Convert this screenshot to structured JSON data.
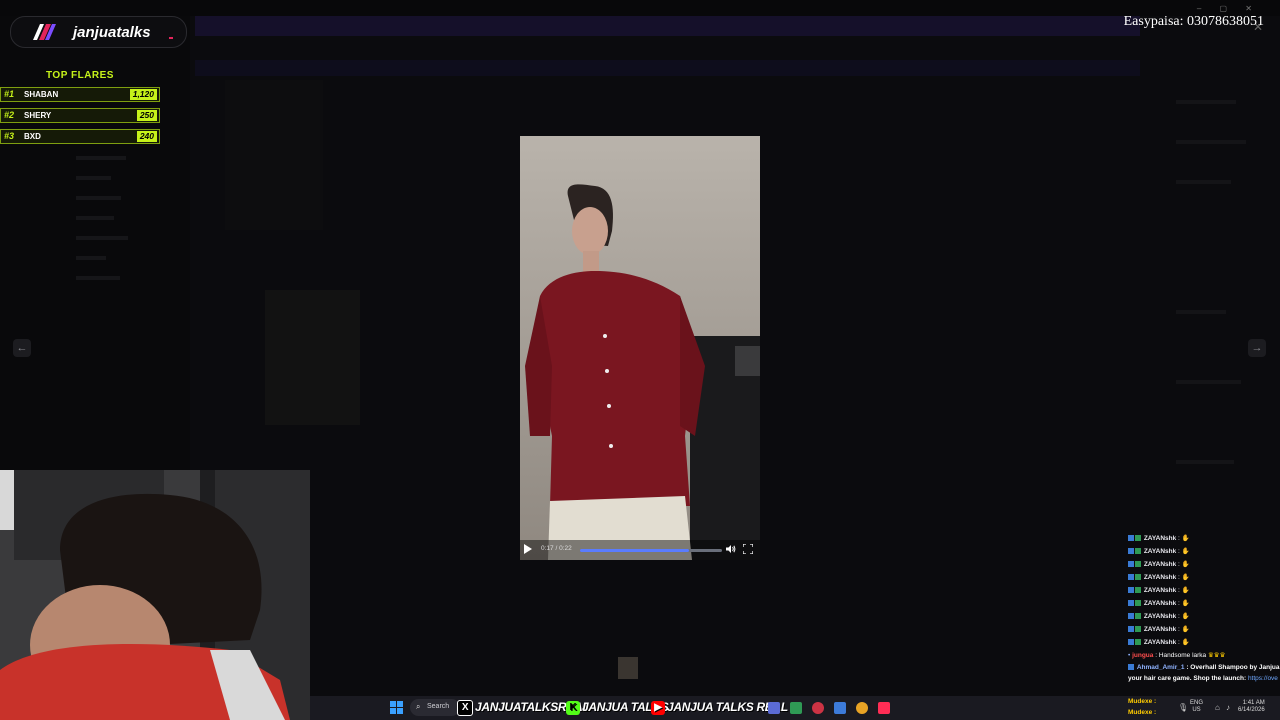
{
  "stream": {
    "logo_text": "janjuatalks",
    "easypaisa": "Easypaisa: 03078638051"
  },
  "top_flares": {
    "title": "TOP FLARES",
    "entries": [
      {
        "rank": "#1",
        "name": "SHABAN",
        "value": "1,120"
      },
      {
        "rank": "#2",
        "name": "SHERY",
        "value": "250"
      },
      {
        "rank": "#3",
        "name": "BXD",
        "value": "240"
      }
    ]
  },
  "video_player": {
    "time": "0:17 / 0:22",
    "progress": 0.77
  },
  "chat": {
    "messages": [
      {
        "user": "ZAYANshk",
        "text": ":"
      },
      {
        "user": "ZAYANshk",
        "text": ":"
      },
      {
        "user": "ZAYANshk",
        "text": ":"
      },
      {
        "user": "ZAYANshk",
        "text": ":"
      },
      {
        "user": "ZAYANshk",
        "text": ":"
      },
      {
        "user": "ZAYANshk",
        "text": ":"
      },
      {
        "user": "ZAYANshk",
        "text": ":"
      },
      {
        "user": "ZAYANshk",
        "text": ":"
      },
      {
        "user": "ZAYANshk",
        "text": ":"
      }
    ],
    "jungua": {
      "user": "jungua",
      "text": ": Handsome larka"
    },
    "sponsor": {
      "user": "Ahmad_Amir_1",
      "text": ": Overhall Shampoo by Janjua",
      "line2": "your hair care game. Shop the launch:",
      "link": "https://ove"
    }
  },
  "taskbar": {
    "search_label": "Search",
    "socials": [
      {
        "label": "JANJUATALKSREAL",
        "icon": "X",
        "color": "#ffffff"
      },
      {
        "label": "JANJUA TALKS",
        "icon": "K",
        "color": "#53fc18"
      },
      {
        "label": "JANJUA TALKS REAL",
        "icon": "▶",
        "color": "#ff0000"
      }
    ],
    "overlay_lines": [
      "Mudexe :",
      "Mudexe :"
    ],
    "lang": [
      "ENG",
      "US"
    ],
    "clock": [
      "1:41 AM",
      "6/14/2026"
    ]
  }
}
